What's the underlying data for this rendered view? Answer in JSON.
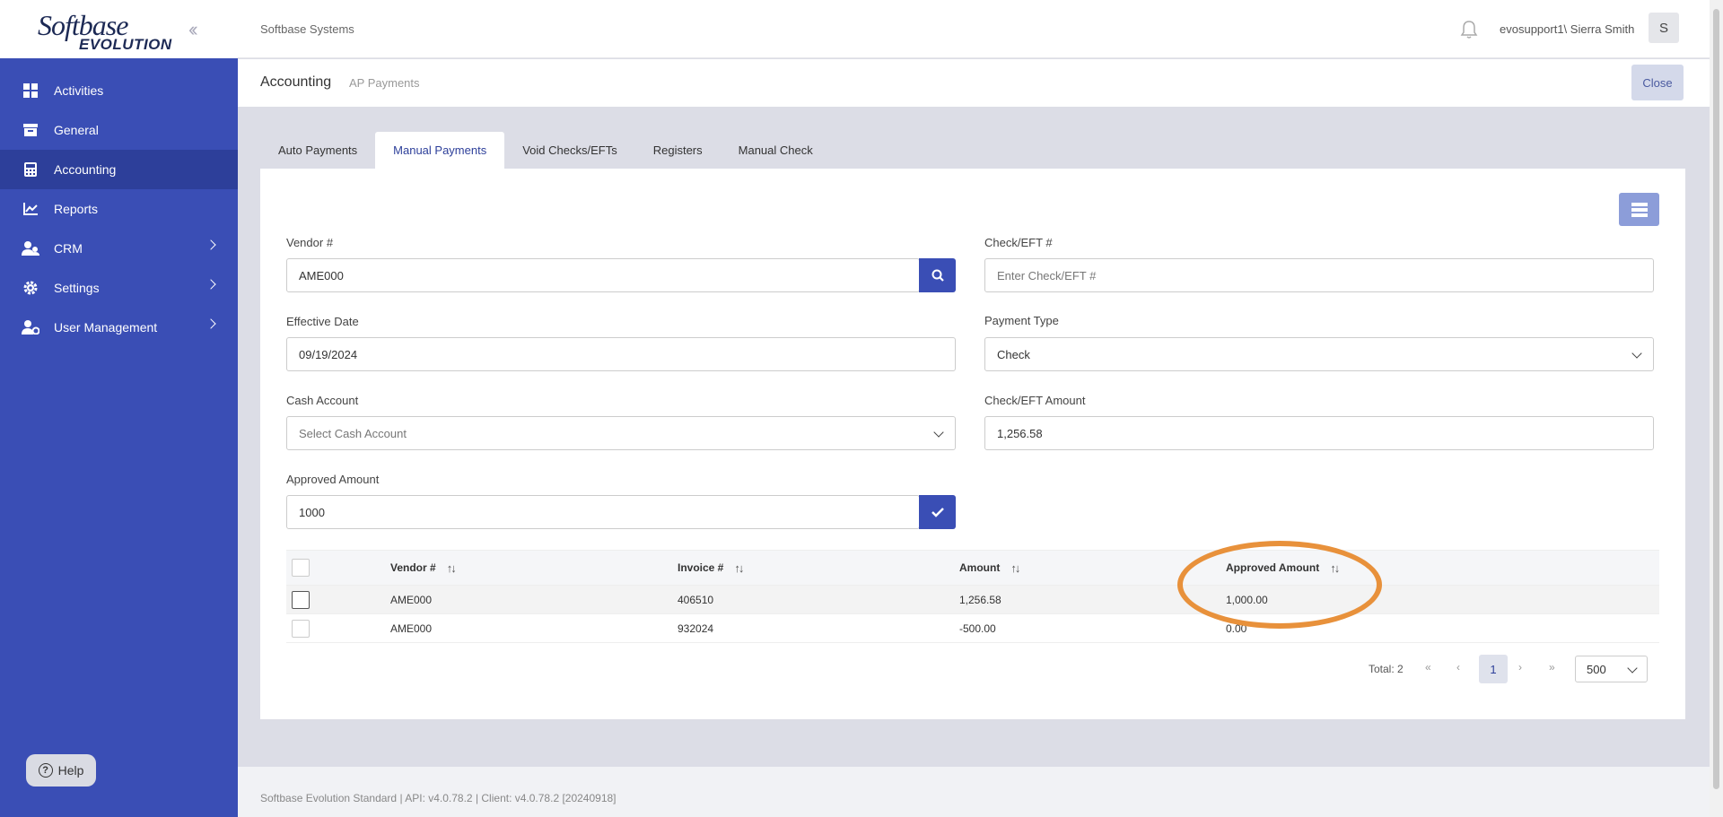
{
  "logo": {
    "line1": "Softbase",
    "line2": "EVOLUTION"
  },
  "sidebar": {
    "items": [
      {
        "label": "Activities",
        "icon": "grid-icon"
      },
      {
        "label": "General",
        "icon": "archive-icon"
      },
      {
        "label": "Accounting",
        "icon": "calculator-icon"
      },
      {
        "label": "Reports",
        "icon": "chart-line-icon"
      },
      {
        "label": "CRM",
        "icon": "users-icon"
      },
      {
        "label": "Settings",
        "icon": "gear-icon"
      },
      {
        "label": "User Management",
        "icon": "user-gear-icon"
      }
    ],
    "help_label": "Help"
  },
  "topbar": {
    "company": "Softbase Systems",
    "user": "evosupport1\\ Sierra Smith",
    "avatar_letter": "S"
  },
  "header": {
    "title": "Accounting",
    "subtitle": "AP Payments",
    "close_label": "Close"
  },
  "tabs": [
    "Auto Payments",
    "Manual Payments",
    "Void Checks/EFTs",
    "Registers",
    "Manual Check"
  ],
  "form": {
    "vendor_label": "Vendor #",
    "vendor_value": "AME000",
    "check_label": "Check/EFT #",
    "check_placeholder": "Enter Check/EFT #",
    "eff_date_label": "Effective Date",
    "eff_date_value": "09/19/2024",
    "payment_type_label": "Payment Type",
    "payment_type_value": "Check",
    "cash_account_label": "Cash Account",
    "cash_account_placeholder": "Select Cash Account",
    "check_amount_label": "Check/EFT Amount",
    "check_amount_value": "1,256.58",
    "approved_label": "Approved Amount",
    "approved_value": "1000"
  },
  "table": {
    "headers": [
      "Vendor #",
      "Invoice #",
      "Amount",
      "Approved Amount"
    ],
    "rows": [
      [
        "AME000",
        "406510",
        "1,256.58",
        "1,000.00"
      ],
      [
        "AME000",
        "932024",
        "-500.00",
        "0.00"
      ]
    ]
  },
  "pager": {
    "total": "Total: 2",
    "page": "1",
    "page_size": "500"
  },
  "footer": "Softbase Evolution Standard | API: v4.0.78.2 | Client: v4.0.78.2 [20240918]",
  "colors": {
    "sidebar": "#3a4eb5",
    "accent": "#2d3f9a",
    "highlight": "#e8913b"
  }
}
